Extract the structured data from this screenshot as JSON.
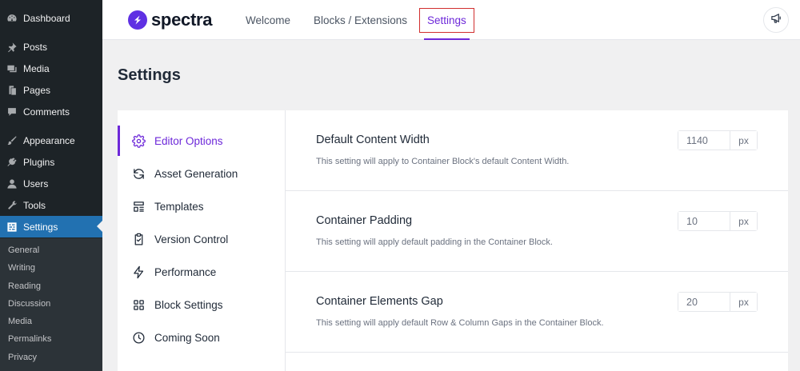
{
  "colors": {
    "accent": "#6d28d9",
    "wp_sidebar": "#1d2327",
    "wp_active": "#2271b1",
    "highlight_box": "#d12e2e"
  },
  "wp_menu": {
    "items": [
      {
        "label": "Dashboard",
        "icon": "dashboard-icon"
      },
      {
        "label": "Posts",
        "icon": "pin-icon"
      },
      {
        "label": "Media",
        "icon": "media-icon"
      },
      {
        "label": "Pages",
        "icon": "pages-icon"
      },
      {
        "label": "Comments",
        "icon": "comment-icon"
      },
      {
        "label": "Appearance",
        "icon": "brush-icon"
      },
      {
        "label": "Plugins",
        "icon": "plug-icon"
      },
      {
        "label": "Users",
        "icon": "user-icon"
      },
      {
        "label": "Tools",
        "icon": "wrench-icon"
      },
      {
        "label": "Settings",
        "icon": "settings-icon",
        "active": true
      }
    ],
    "submenu": [
      "General",
      "Writing",
      "Reading",
      "Discussion",
      "Media",
      "Permalinks",
      "Privacy"
    ]
  },
  "header": {
    "logo_text": "spectra",
    "tabs": [
      {
        "label": "Welcome"
      },
      {
        "label": "Blocks / Extensions"
      },
      {
        "label": "Settings",
        "active": true
      }
    ],
    "announce_icon": "megaphone-icon"
  },
  "page_title": "Settings",
  "settings_nav": [
    {
      "label": "Editor Options",
      "icon": "gear-icon",
      "active": true
    },
    {
      "label": "Asset Generation",
      "icon": "refresh-icon"
    },
    {
      "label": "Templates",
      "icon": "template-icon"
    },
    {
      "label": "Version Control",
      "icon": "clipboard-check-icon"
    },
    {
      "label": "Performance",
      "icon": "bolt-icon"
    },
    {
      "label": "Block Settings",
      "icon": "blocks-icon"
    },
    {
      "label": "Coming Soon",
      "icon": "clock-icon"
    }
  ],
  "settings": [
    {
      "title": "Default Content Width",
      "description": "This setting will apply to Container Block's default Content Width.",
      "value": "1140",
      "unit": "px"
    },
    {
      "title": "Container Padding",
      "description": "This setting will apply default padding in the Container Block.",
      "value": "10",
      "unit": "px"
    },
    {
      "title": "Container Elements Gap",
      "description": "This setting will apply default Row & Column Gaps in the Container Block.",
      "value": "20",
      "unit": "px"
    }
  ]
}
